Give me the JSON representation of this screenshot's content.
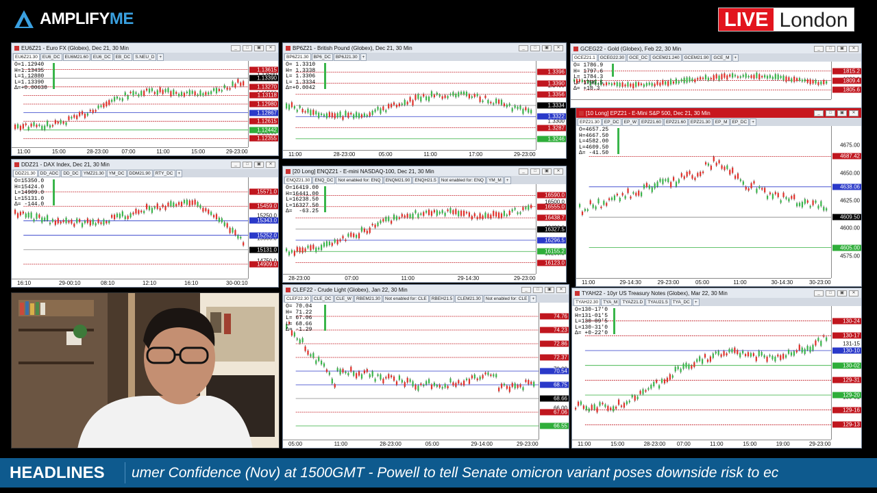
{
  "brand": {
    "name_part1": "AMPLIFY",
    "name_part2": "ME",
    "icon": "triangle-logo-icon"
  },
  "live_badge": {
    "live": "LIVE",
    "city": "London"
  },
  "ticker": {
    "label": "HEADLINES",
    "text": "umer Confidence (Nov) at 1500GMT - Powell to tell Senate omicron variant poses downside risk to ec"
  },
  "colors": {
    "up": "#39b54a",
    "down": "#e0302a",
    "level_red": "#c0161e",
    "level_blue": "#2a39c9",
    "level_green": "#2fae3a",
    "tick_bg": "#0e5a8e"
  },
  "windows": [
    {
      "id": "eur",
      "title": "EU6Z21 - Euro FX (Globex), Dec 21, 30 Min",
      "tabs": [
        "EU6Z21.30",
        "EU6_DC",
        "EU6M21.60",
        "EU6_DC",
        "EB_DC",
        "S.NEU_D",
        "+"
      ],
      "info": [
        "O=1.12940",
        "H=1.13435",
        "L=1.12880",
        "L=1.13390",
        "Δ=+0.00630"
      ],
      "y_ticks": [
        "1.13500",
        "1.13000",
        "1.12750",
        "1.12500"
      ],
      "tags": [
        {
          "t": "1.13615",
          "c": "#c0161e"
        },
        {
          "t": "1.13390",
          "c": "#000"
        },
        {
          "t": "1.13270",
          "c": "#c0161e"
        },
        {
          "t": "1.13118",
          "c": "#c0161e"
        },
        {
          "t": "1.12980",
          "c": "#c0161e"
        },
        {
          "t": "1.12867",
          "c": "#2a39c9"
        },
        {
          "t": "1.12615",
          "c": "#c0161e"
        },
        {
          "t": "1.12442",
          "c": "#2fae3a"
        },
        {
          "t": "1.12355",
          "c": "#c0161e"
        }
      ],
      "x_ticks": [
        "11:00",
        "15:00",
        "28-23:00",
        "07:00",
        "11:00",
        "15:00",
        "29-23:00"
      ],
      "trend": "up"
    },
    {
      "id": "gbp",
      "title": "BP6Z21 - British Pound (Globex), Dec 21, 30 Min",
      "tabs": [
        "BP6Z21.30",
        "BP6_DC",
        "BP6J21.30",
        "+"
      ],
      "info": [
        "O= 1.3310",
        "H= 1.3338",
        "L= 1.3306",
        "L= 1.3334",
        "Δ=+0.0042"
      ],
      "y_ticks": [
        "1.3400",
        "1.3300"
      ],
      "tags": [
        {
          "t": "1.3396",
          "c": "#c0161e"
        },
        {
          "t": "1.3390",
          "c": "#c0161e"
        },
        {
          "t": "1.3356",
          "c": "#c0161e"
        },
        {
          "t": "1.3334",
          "c": "#000"
        },
        {
          "t": "1.3322",
          "c": "#2a39c9"
        },
        {
          "t": "1.3287",
          "c": "#c0161e"
        },
        {
          "t": "1.3246",
          "c": "#2fae3a"
        }
      ],
      "x_ticks": [
        "11:00",
        "28-23:00",
        "05:00",
        "11:00",
        "17:00",
        "29-23:00"
      ],
      "trend": "flat"
    },
    {
      "id": "gold",
      "title": "GCEG22 - Gold (Globex), Feb 22, 30 Min",
      "tabs": [
        "GCEZ21.1",
        "GCEG22.30",
        "GCE_DC",
        "GCEM21.240",
        "GCEM21.90",
        "GCE_M",
        "+"
      ],
      "info": [
        "O= 1786.9",
        "H= 1797.6",
        "L= 1784.3",
        "L= 1795.5",
        "Δ= +10.3"
      ],
      "y_ticks": [
        "1820.0"
      ],
      "tags": [
        {
          "t": "1815.2",
          "c": "#c0161e"
        },
        {
          "t": "1809.4",
          "c": "#c0161e"
        },
        {
          "t": "1805.6",
          "c": "#c0161e"
        }
      ],
      "x_ticks": [],
      "trend": "flat"
    },
    {
      "id": "dax",
      "title": "DDZ21 - DAX Index, Dec 21, 30 Min",
      "tabs": [
        "DDZ21.30",
        "DD_ADC",
        "DD_DC",
        "YMZ21.30",
        "YM_DC",
        "DDM21.90",
        "RTY_DC",
        "+"
      ],
      "info": [
        "O=15350.0",
        "H=15424.0",
        "L=14909.0",
        "L=15131.0",
        "Δ= -144.0"
      ],
      "y_ticks": [
        "15750.0",
        "15250.0",
        "15000.0",
        "14750.0"
      ],
      "tags": [
        {
          "t": "15571.0",
          "c": "#c0161e"
        },
        {
          "t": "15459.0",
          "c": "#c0161e"
        },
        {
          "t": "15343.0",
          "c": "#2a39c9"
        },
        {
          "t": "15252.0",
          "c": "#2a39c9"
        },
        {
          "t": "15131.0",
          "c": "#000"
        },
        {
          "t": "14909.0",
          "c": "#c0161e"
        }
      ],
      "x_ticks": [
        "16:10",
        "29-00:10",
        "08:10",
        "12:10",
        "16:10",
        "30-00:10"
      ],
      "trend": "down"
    },
    {
      "id": "nq",
      "title": "[20 Long]  ENQZ21 - E-mini NASDAQ-100, Dec 21, 30 Min",
      "tabs": [
        "ENQZ21.30",
        "ENQ_DC",
        "Not enabled for: ENQ",
        "ENQM21.90",
        "ENQH21.5",
        "Not enabled for: ENQ",
        "YM_M",
        "+"
      ],
      "info": [
        "O=16419.00",
        "H=16441.00",
        "L=16238.50",
        "L=16327.50",
        "Δ=  -63.25"
      ],
      "y_ticks": [
        "16500.0",
        "16400.0",
        "16200.0"
      ],
      "tags": [
        {
          "t": "16590.0",
          "c": "#c0161e"
        },
        {
          "t": "16555.0",
          "c": "#c0161e"
        },
        {
          "t": "16438.7",
          "c": "#c0161e"
        },
        {
          "t": "16327.5",
          "c": "#000"
        },
        {
          "t": "16296.5",
          "c": "#2a39c9"
        },
        {
          "t": "16155.2",
          "c": "#2fae3a"
        },
        {
          "t": "16123.0",
          "c": "#c0161e"
        }
      ],
      "x_ticks": [
        "28-23:00",
        "07:00",
        "11:00",
        "29-14:30",
        "29-23:00"
      ],
      "trend": "upflat"
    },
    {
      "id": "es",
      "title": "[10 Long]  EPZ21 - E-Mini S&P 500, Dec 21, 30 Min",
      "tabs": [
        "EPZ21.30",
        "EP_DC",
        "EP_W",
        "EPZ21.60",
        "EPZ21.60",
        "EPZ21.30",
        "EP_M",
        "EP_DC",
        "+"
      ],
      "info": [
        "O=4657.25",
        "H=4667.50",
        "L=4582.00",
        "L=4609.50",
        "Δ= -41.50"
      ],
      "y_ticks": [
        "4675.00",
        "4650.00",
        "4625.00",
        "4600.00",
        "4575.00"
      ],
      "tags": [
        {
          "t": "4687.42",
          "c": "#c0161e"
        },
        {
          "t": "4638.06",
          "c": "#2a39c9"
        },
        {
          "t": "4609.50",
          "c": "#000"
        },
        {
          "t": "4605.00",
          "c": "#2fae3a"
        }
      ],
      "x_ticks": [
        "11:00",
        "29-14:30",
        "29-23:00",
        "05:00",
        "11:00",
        "30-14:30",
        "30-23:00"
      ],
      "trend": "humpdrop"
    },
    {
      "id": "cl",
      "title": "CLEF22 - Crude Light (Globex), Jan 22, 30 Min",
      "tabs": [
        "CLEF22.30",
        "CLE_DC",
        "CLE_W",
        "RBEM21.30",
        "Not enabled for: CLE",
        "RBEH21.5",
        "CLEM21.30",
        "Not enabled for: CLE",
        "+"
      ],
      "info": [
        "O= 70.04",
        "H= 71.22",
        "L= 67.06",
        "L= 68.66",
        "Δ= -1.29"
      ],
      "y_ticks": [
        "76.00",
        "70.00",
        "66.00"
      ],
      "tags": [
        {
          "t": "74.76",
          "c": "#c0161e"
        },
        {
          "t": "74.23",
          "c": "#c0161e"
        },
        {
          "t": "72.86",
          "c": "#c0161e"
        },
        {
          "t": "72.37",
          "c": "#c0161e"
        },
        {
          "t": "70.54",
          "c": "#2a39c9"
        },
        {
          "t": "68.75",
          "c": "#2a39c9"
        },
        {
          "t": "68.66",
          "c": "#000"
        },
        {
          "t": "67.06",
          "c": "#c0161e"
        },
        {
          "t": "66.55",
          "c": "#2fae3a"
        }
      ],
      "x_ticks": [
        "05:00",
        "11:00",
        "28-23:00",
        "05:00",
        "29-14:00",
        "29-23:00"
      ],
      "trend": "dropflat"
    },
    {
      "id": "ty",
      "title": "TYAH22 - 10yr US Treasury Notes (Globex), Mar 22, 30 Min",
      "tabs": [
        "TYAH22.30",
        "TYA_M",
        "TYAZ21.D",
        "TYAU21.5",
        "TYA_DC",
        "+"
      ],
      "info": [
        "O=130-17'0",
        "H=131-01'5",
        "L=130-09'5",
        "L=130-31'0",
        "Δ= +0-22'0"
      ],
      "y_ticks": [
        "131-15",
        "130-31"
      ],
      "tags": [
        {
          "t": "130-24",
          "c": "#c0161e"
        },
        {
          "t": "130-17",
          "c": "#c0161e"
        },
        {
          "t": "130-10",
          "c": "#2a39c9"
        },
        {
          "t": "130-02",
          "c": "#2fae3a"
        },
        {
          "t": "129-31",
          "c": "#c0161e"
        },
        {
          "t": "129-20",
          "c": "#2fae3a"
        },
        {
          "t": "129-16",
          "c": "#c0161e"
        },
        {
          "t": "129-13",
          "c": "#c0161e"
        }
      ],
      "x_ticks": [
        "11:00",
        "15:00",
        "28-23:00",
        "07:00",
        "11:00",
        "15:00",
        "19:00",
        "29-23:00"
      ],
      "trend": "up"
    }
  ]
}
